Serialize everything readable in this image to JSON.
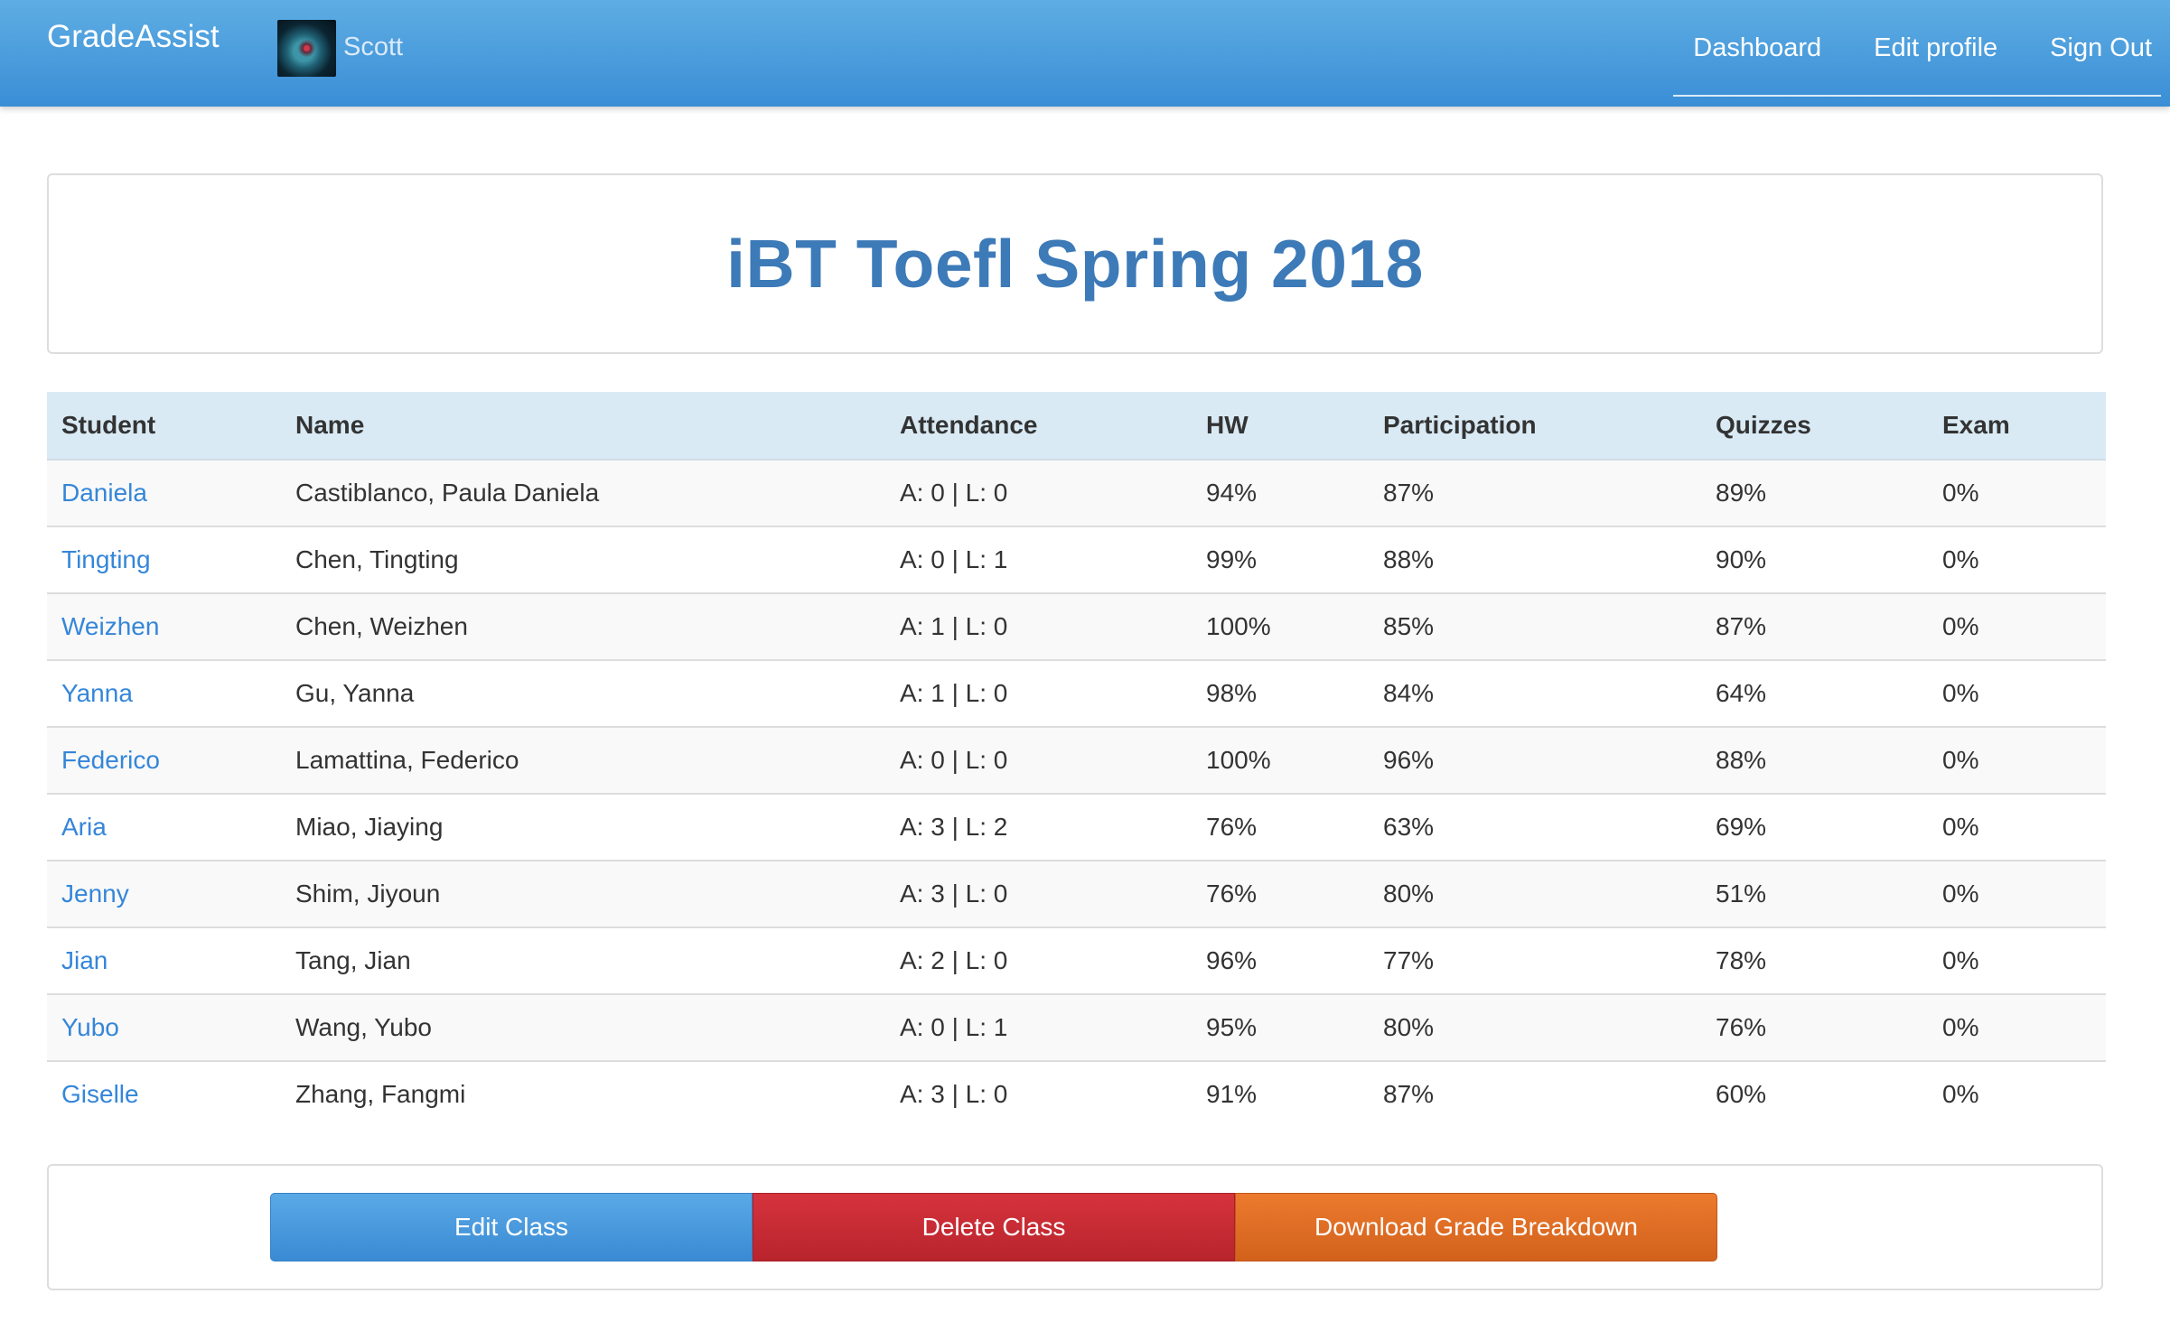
{
  "navbar": {
    "brand": "GradeAssist",
    "user_name": "Scott",
    "links": [
      "Dashboard",
      "Edit profile",
      "Sign Out"
    ]
  },
  "page": {
    "title": "iBT Toefl Spring 2018"
  },
  "table": {
    "headers": [
      "Student",
      "Name",
      "Attendance",
      "HW",
      "Participation",
      "Quizzes",
      "Exam"
    ],
    "rows": [
      {
        "student": "Daniela",
        "name": "Castiblanco, Paula Daniela",
        "attendance": "A: 0 | L: 0",
        "hw": "94%",
        "participation": "87%",
        "quizzes": "89%",
        "exam": "0%"
      },
      {
        "student": "Tingting",
        "name": "Chen, Tingting",
        "attendance": "A: 0 | L: 1",
        "hw": "99%",
        "participation": "88%",
        "quizzes": "90%",
        "exam": "0%"
      },
      {
        "student": "Weizhen",
        "name": "Chen, Weizhen",
        "attendance": "A: 1 | L: 0",
        "hw": "100%",
        "participation": "85%",
        "quizzes": "87%",
        "exam": "0%"
      },
      {
        "student": "Yanna",
        "name": "Gu, Yanna",
        "attendance": "A: 1 | L: 0",
        "hw": "98%",
        "participation": "84%",
        "quizzes": "64%",
        "exam": "0%"
      },
      {
        "student": "Federico",
        "name": "Lamattina, Federico",
        "attendance": "A: 0 | L: 0",
        "hw": "100%",
        "participation": "96%",
        "quizzes": "88%",
        "exam": "0%"
      },
      {
        "student": "Aria",
        "name": "Miao, Jiaying",
        "attendance": "A: 3 | L: 2",
        "hw": "76%",
        "participation": "63%",
        "quizzes": "69%",
        "exam": "0%"
      },
      {
        "student": "Jenny",
        "name": "Shim, Jiyoun",
        "attendance": "A: 3 | L: 0",
        "hw": "76%",
        "participation": "80%",
        "quizzes": "51%",
        "exam": "0%"
      },
      {
        "student": "Jian",
        "name": "Tang, Jian",
        "attendance": "A: 2 | L: 0",
        "hw": "96%",
        "participation": "77%",
        "quizzes": "78%",
        "exam": "0%"
      },
      {
        "student": "Yubo",
        "name": "Wang, Yubo",
        "attendance": "A: 0 | L: 1",
        "hw": "95%",
        "participation": "80%",
        "quizzes": "76%",
        "exam": "0%"
      },
      {
        "student": "Giselle",
        "name": "Zhang, Fangmi",
        "attendance": "A: 3 | L: 0",
        "hw": "91%",
        "participation": "87%",
        "quizzes": "60%",
        "exam": "0%"
      }
    ]
  },
  "actions": {
    "edit_label": "Edit Class",
    "delete_label": "Delete Class",
    "download_label": "Download Grade Breakdown"
  },
  "colors": {
    "navbar": "#4a9de0",
    "title": "#3d7ab8",
    "link": "#3586d9",
    "table_header_bg": "#d9eaf5",
    "edit_button": "#4a98dd",
    "delete_button": "#c72c35",
    "download_button": "#df6d25"
  },
  "icons": {
    "avatar": "nebula-avatar-image"
  }
}
